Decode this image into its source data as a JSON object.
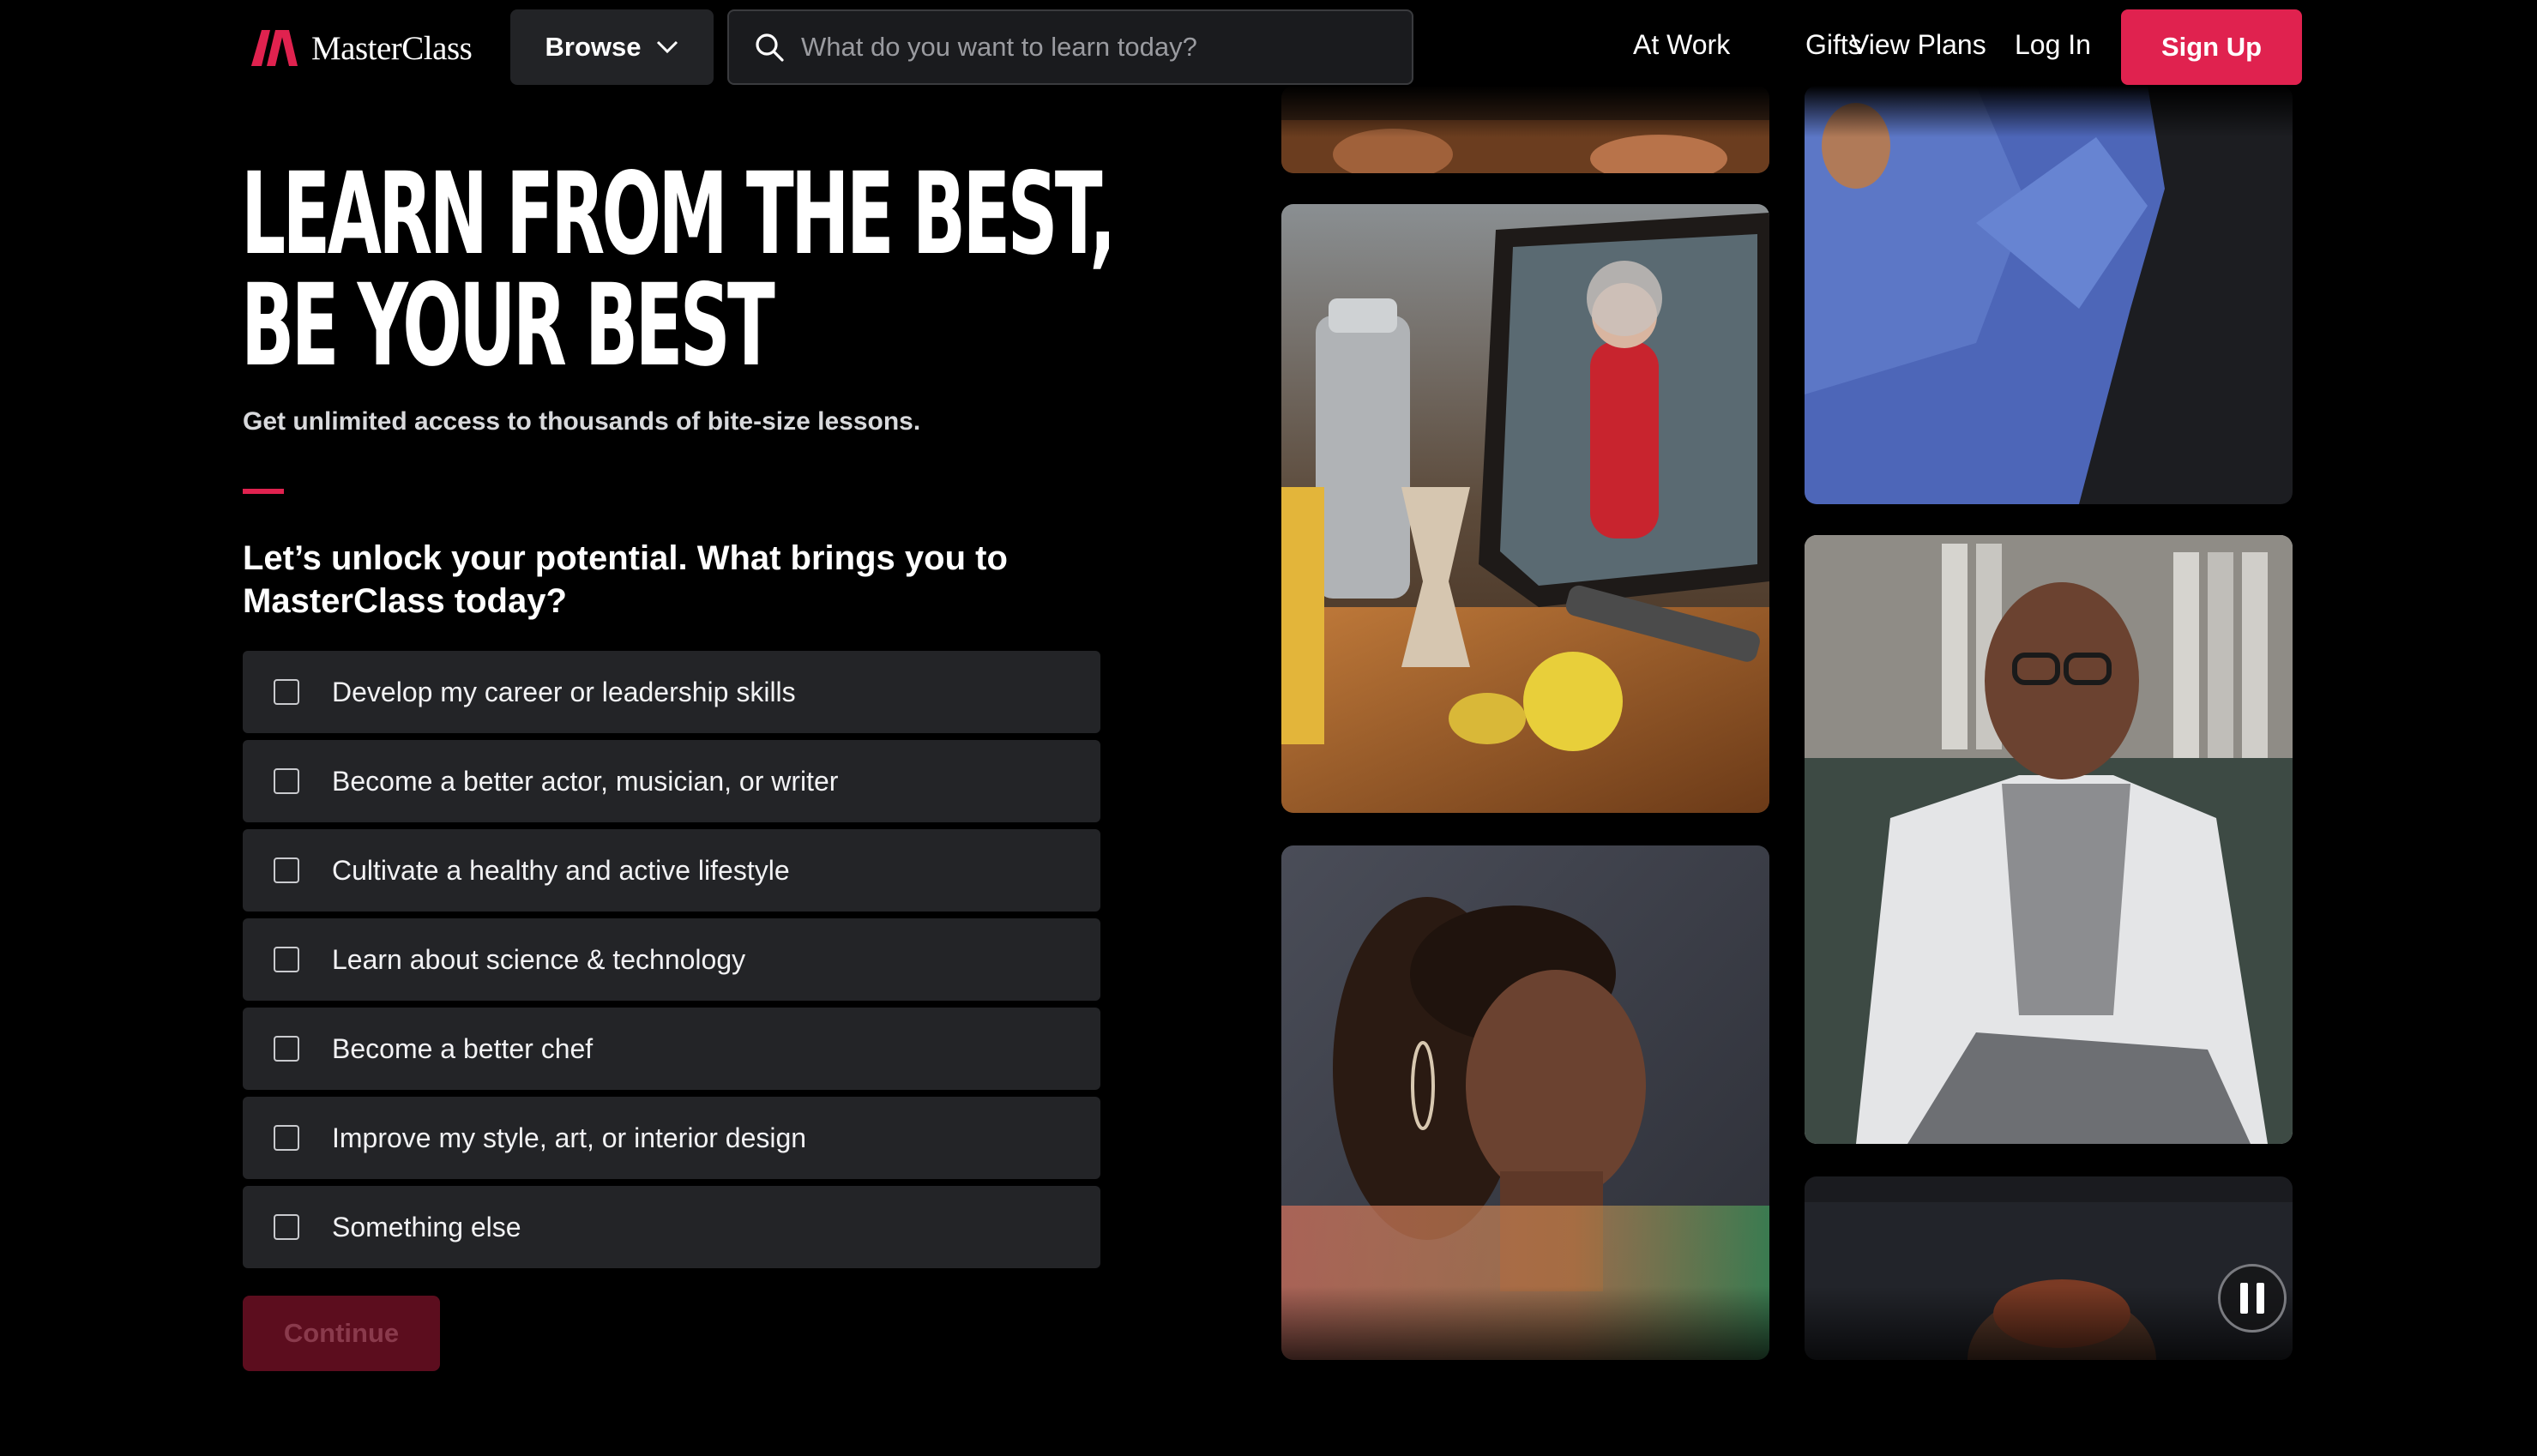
{
  "header": {
    "logo_text": "MasterClass",
    "browse_label": "Browse",
    "search_placeholder": "What do you want to learn today?",
    "nav": [
      "At Work",
      "Gifts",
      "View Plans",
      "Log In"
    ],
    "signup_label": "Sign Up"
  },
  "hero": {
    "headline_line1": "LEARN FROM THE BEST,",
    "headline_line2": "BE YOUR BEST",
    "subhead": "Get unlimited access to thousands of bite-size lessons."
  },
  "quiz": {
    "question": "Let’s unlock your potential. What brings you to MasterClass today?",
    "options": [
      "Develop my career or leadership skills",
      "Become a better actor, musician, or writer",
      "Cultivate a healthy and active lifestyle",
      "Learn about science & technology",
      "Become a better chef",
      "Improve my style, art, or interior design",
      "Something else"
    ],
    "continue_label": "Continue"
  },
  "colors": {
    "accent": "#e0224f",
    "background": "#000000",
    "option_bg": "#232427"
  }
}
